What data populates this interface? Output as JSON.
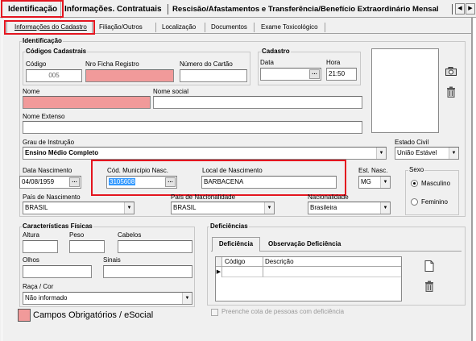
{
  "tabs": {
    "main": [
      "Identificação",
      "Informações. Contratuais",
      "Rescisão/Afastamentos e Transferência/Benefício Extraordinário Mensal"
    ],
    "sub": [
      "Informações do Cadastro",
      "Filiação/Outros",
      "Localização",
      "Documentos",
      "Exame Toxicológico"
    ]
  },
  "ident": {
    "title": "Identificação",
    "codigos_title": "Códigos Cadastrais",
    "codigo_label": "Código",
    "codigo_value": "005",
    "ficha_label": "Nro Ficha Registro",
    "ficha_value": "",
    "cartao_label": "Número do Cartão",
    "cartao_value": "",
    "cad_title": "Cadastro",
    "data_label": "Data",
    "data_value": "",
    "hora_label": "Hora",
    "hora_value": "21:50",
    "nome_label": "Nome",
    "nome_value": "",
    "nome_social_label": "Nome social",
    "nome_social_value": "",
    "nome_ext_label": "Nome Extenso",
    "nome_ext_value": "",
    "grau_label": "Grau de Instrução",
    "grau_value": "Ensino Médio Completo",
    "civil_label": "Estado Civil",
    "civil_value": "União Estável",
    "nasc_label": "Data Nascimento",
    "nasc_value": "04/08/1959",
    "mun_label": "Cód. Município Nasc.",
    "mun_value": "3105608",
    "local_label": "Local de Nascimento",
    "local_value": "BARBACENA",
    "uf_label": "Est. Nasc.",
    "uf_value": "MG",
    "sexo_title": "Sexo",
    "sexo_m": "Masculino",
    "sexo_f": "Feminino",
    "sexo_selected": "Masculino",
    "pais_label": "País de Nascimento",
    "pais_value": "BRASIL",
    "paisnac_label": "País de Nacionalidade",
    "paisnac_value": "BRASIL",
    "nac_label": "Nacionalidade",
    "nac_value": "Brasileira"
  },
  "fisicas": {
    "title": "Características Físicas",
    "altura": "Altura",
    "peso": "Peso",
    "cabelos": "Cabelos",
    "olhos": "Olhos",
    "sinais": "Sinais",
    "raca_label": "Raça / Cor",
    "raca_value": "Não informado"
  },
  "deficiencias": {
    "title": "Deficiências",
    "tab1": "Deficiência",
    "tab2": "Observação Deficiência",
    "col1": "Código",
    "col2": "Descrição",
    "check_label": "Preenche cota de pessoas com deficiência"
  },
  "legend": {
    "label": "Campos Obrigatórios / eSocial",
    "color": "#f19a9a"
  },
  "colors": {
    "highlight": "#e4151f",
    "required": "#f19a9a",
    "selection": "#3399ff"
  }
}
